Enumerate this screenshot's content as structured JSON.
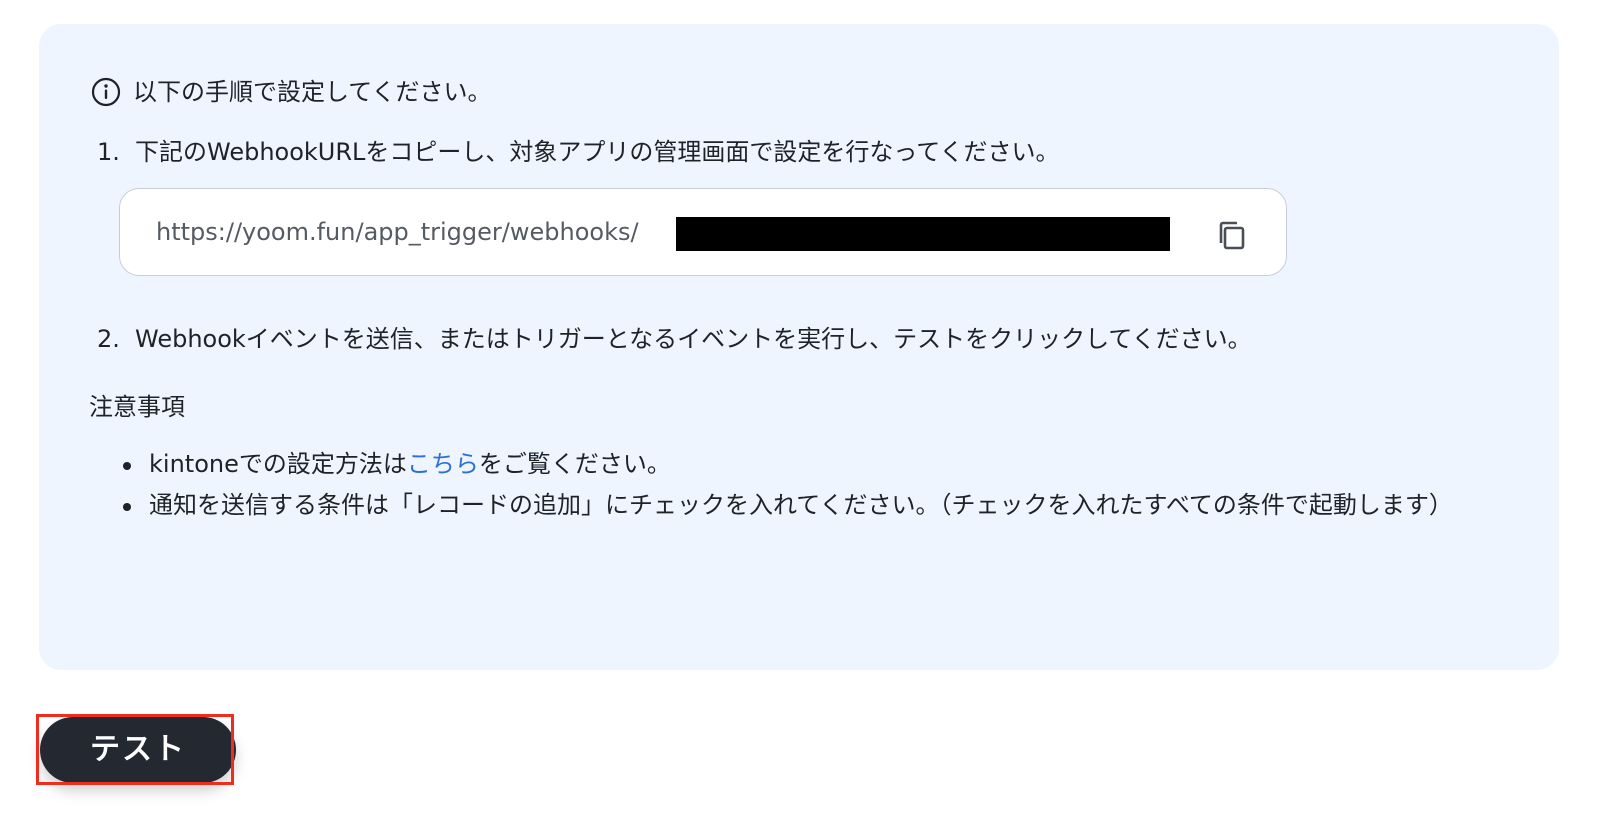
{
  "instructions": {
    "header": "以下の手順で設定してください。",
    "step1_number": "1.",
    "step1_text": "下記のWebhookURLをコピーし、対象アプリの管理画面で設定を行なってください。",
    "webhook_url": "https://yoom.fun/app_trigger/webhooks/",
    "step2_number": "2.",
    "step2_text": "Webhookイベントを送信、またはトリガーとなるイベントを実行し、テストをクリックしてください。"
  },
  "notes": {
    "title": "注意事項",
    "item1_before": "kintoneでの設定方法は",
    "item1_link": "こちら",
    "item1_after": "をご覧ください。",
    "item2": "通知を送信する条件は「レコードの追加」にチェックを入れてください。（チェックを入れたすべての条件で起動します）"
  },
  "actions": {
    "test_label": "テスト"
  },
  "icons": {
    "info": "info-icon",
    "copy": "copy-icon"
  },
  "colors": {
    "panel_bg": "#eef5fe",
    "link": "#2d6fd8",
    "button_bg": "#232831",
    "highlight": "#ee2d1e"
  }
}
